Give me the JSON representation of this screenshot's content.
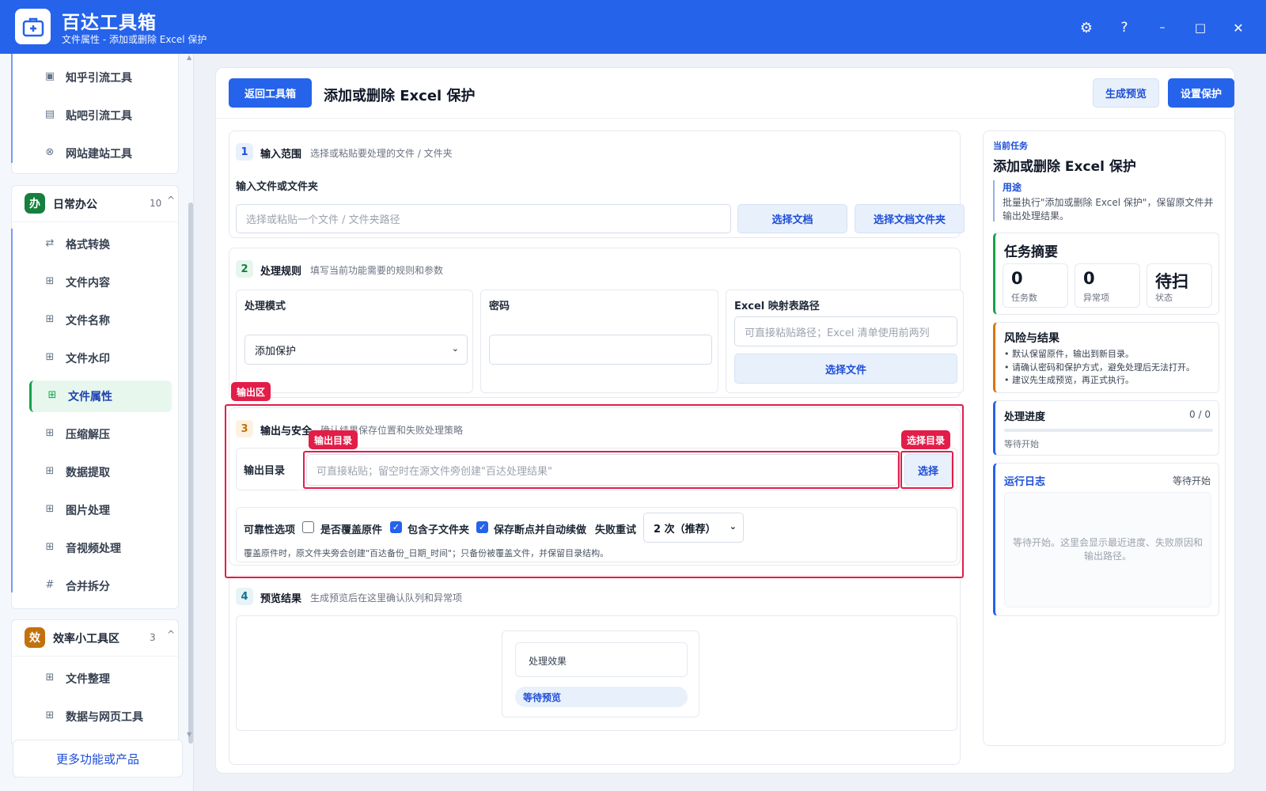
{
  "app": {
    "title": "百达工具箱",
    "subtitle": "文件属性 - 添加或删除 Excel 保护"
  },
  "window_controls": {
    "settings": "⚙",
    "help": "?",
    "minimize": "–",
    "maximize": "□",
    "close": "✕"
  },
  "sidebar": {
    "top_items": [
      {
        "icon": "image-icon",
        "label": "知乎引流工具"
      },
      {
        "icon": "doc-icon",
        "label": "贴吧引流工具"
      },
      {
        "icon": "globe-icon",
        "label": "网站建站工具"
      }
    ],
    "groups": [
      {
        "badge": "办",
        "name": "日常办公",
        "count": "10",
        "arrow": "^",
        "color": "#15803d",
        "items": [
          {
            "icon": "⇄",
            "label": "格式转换"
          },
          {
            "icon": "⊞",
            "label": "文件内容"
          },
          {
            "icon": "⊞",
            "label": "文件名称"
          },
          {
            "icon": "⊞",
            "label": "文件水印"
          },
          {
            "icon": "⊞",
            "label": "文件属性",
            "active": true
          },
          {
            "icon": "⊞",
            "label": "压缩解压"
          },
          {
            "icon": "⊞",
            "label": "数据提取"
          },
          {
            "icon": "⊞",
            "label": "图片处理"
          },
          {
            "icon": "⊞",
            "label": "音视频处理"
          },
          {
            "icon": "#",
            "label": "合并拆分"
          }
        ]
      },
      {
        "badge": "效",
        "name": "效率小工具区",
        "count": "3",
        "arrow": "^",
        "color": "#c2710c",
        "items": [
          {
            "icon": "⊞",
            "label": "文件整理"
          },
          {
            "icon": "⊞",
            "label": "数据与网页工具"
          }
        ]
      }
    ],
    "more_button": "更多功能或产品"
  },
  "header": {
    "back_button": "返回工具箱",
    "title": "添加或删除 Excel 保护",
    "preview_button": "生成预览",
    "run_button": "设置保护"
  },
  "section1": {
    "num": "1",
    "title": "输入范围",
    "desc": "选择或粘贴要处理的文件 / 文件夹",
    "field_label": "输入文件或文件夹",
    "input_placeholder": "选择或粘贴一个文件 / 文件夹路径",
    "btn_select_doc": "选择文档",
    "btn_select_folder": "选择文档文件夹"
  },
  "section2": {
    "num": "2",
    "title": "处理规则",
    "desc": "填写当前功能需要的规则和参数",
    "mode_label": "处理模式",
    "mode_value": "添加保护",
    "password_label": "密码",
    "password_value": "",
    "excel_label": "Excel 映射表路径",
    "excel_placeholder": "可直接粘贴路径；Excel 清单使用前两列",
    "excel_btn": "选择文件"
  },
  "section3": {
    "num": "3",
    "title": "输出与安全",
    "desc": "确认结果保存位置和失败处理策略",
    "output_label": "输出目录",
    "output_placeholder": "可直接粘贴；留空时在源文件旁创建\"百达处理结果\"",
    "select_btn": "选择",
    "reliability_label": "可靠性选项",
    "opt_overwrite": "是否覆盖原件",
    "opt_overwrite_checked": false,
    "opt_subfolders": "包含子文件夹",
    "opt_subfolders_checked": true,
    "opt_resume": "保存断点并自动续做",
    "opt_resume_checked": true,
    "retry_label": "失败重试",
    "retry_value": "2 次（推荐）",
    "note": "覆盖原件时，原文件夹旁会创建\"百达备份_日期_时间\"；只备份被覆盖文件，并保留目录结构。"
  },
  "section4": {
    "num": "4",
    "title": "预览结果",
    "desc": "生成预览后在这里确认队列和异常项",
    "effect_label": "处理效果",
    "status_pill": "等待预览"
  },
  "annotations": {
    "output_area": "输出区",
    "output_dir": "输出目录",
    "select_dir": "选择目录"
  },
  "right_panel": {
    "current_task_label": "当前任务",
    "task_title": "添加或删除 Excel 保护",
    "purpose_label": "用途",
    "purpose_text": "批量执行\"添加或删除 Excel 保护\"，保留原文件并输出处理结果。",
    "summary_title": "任务摘要",
    "stats": [
      {
        "value": "0",
        "label": "任务数"
      },
      {
        "value": "0",
        "label": "异常项"
      },
      {
        "value": "待扫",
        "label": "状态"
      }
    ],
    "risk_title": "风险与结果",
    "risks": [
      "默认保留原件，输出到新目录。",
      "请确认密码和保护方式，避免处理后无法打开。",
      "建议先生成预览，再正式执行。"
    ],
    "progress_title": "处理进度",
    "progress_count": "0 / 0",
    "progress_value": 0,
    "progress_status": "等待开始",
    "log_title": "运行日志",
    "log_status": "等待开始",
    "log_placeholder": "等待开始。这里会显示最近进度、失败原因和输出路径。"
  },
  "colors": {
    "brand": "#2563eb",
    "annotation": "#e11d48",
    "group_office": "#15803d",
    "group_tools": "#c2710c"
  }
}
